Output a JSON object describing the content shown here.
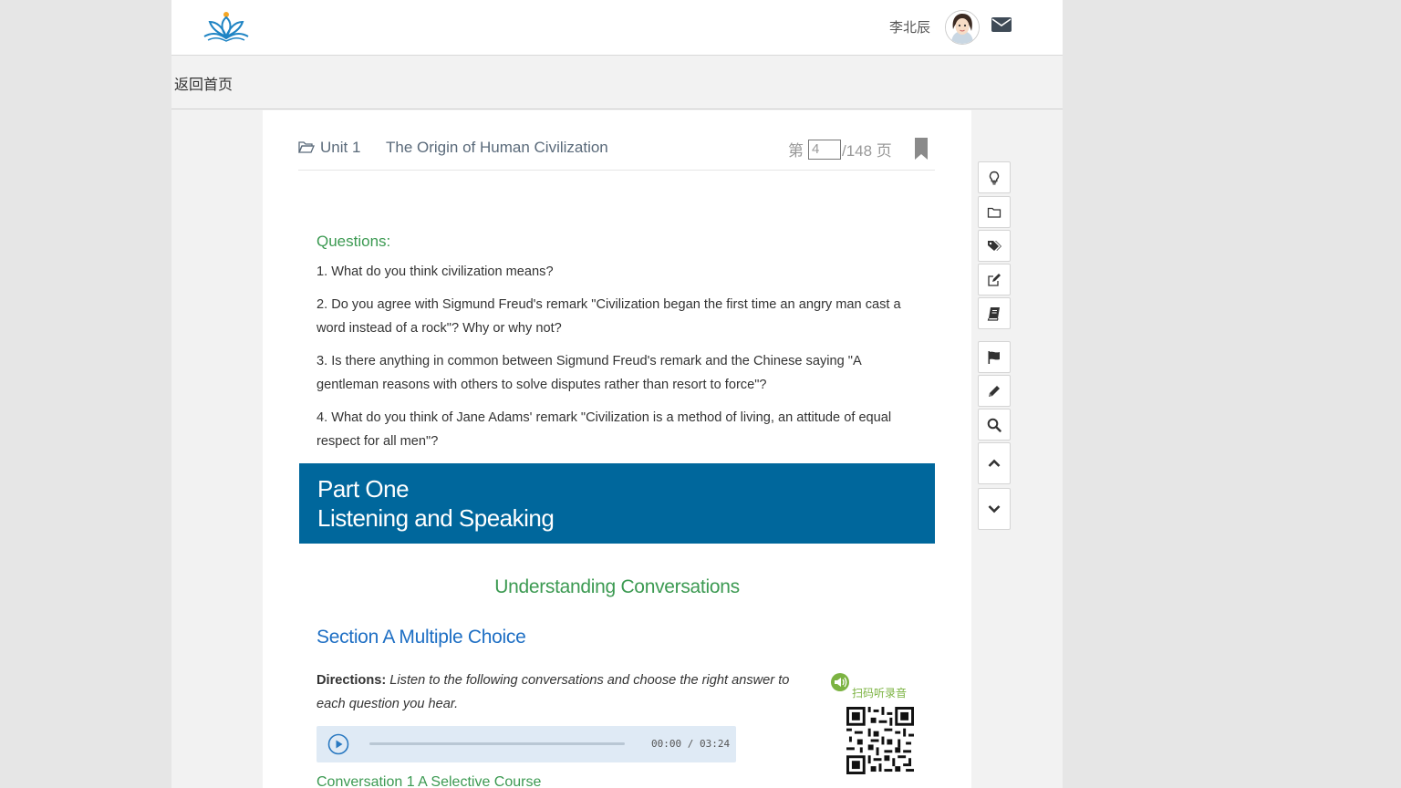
{
  "header": {
    "username": "李北辰",
    "back_link": "返回首页"
  },
  "page_header": {
    "unit_label": "Unit 1",
    "unit_title": "The Origin of Human Civilization",
    "page_prefix": "第",
    "page_current": "4",
    "page_suffix": "/148 页"
  },
  "content": {
    "questions_title": "Questions:",
    "questions": [
      "1. What do you think civilization means?",
      "2. Do you agree with Sigmund Freud's remark \"Civilization began the first time an angry man cast a word instead of a rock\"? Why or why not?",
      "3. Is there anything in common between Sigmund Freud's remark and the Chinese saying \"A gentleman reasons with others to solve disputes rather than resort to force\"?",
      "4. What do you think of Jane Adams' remark \"Civilization is a method of living, an attitude of equal respect for all men\"?"
    ],
    "part_line1": "Part One",
    "part_line2": "Listening and Speaking",
    "subsection_title": "Understanding Conversations",
    "section_title": "Section A Multiple Choice",
    "directions_label": "Directions:",
    "directions_text": "Listen to the following conversations and choose the right answer to each question you hear.",
    "qr_label": "扫码听录音",
    "audio_time": "00:00 / 03:24",
    "audio_progress": 0,
    "conversation_title": "Conversation 1 A Selective Course"
  },
  "toolbar": {
    "items": [
      "lightbulb-icon",
      "folder-icon",
      "tags-icon",
      "edit-icon",
      "book-icon",
      "flag-icon",
      "pencil-icon",
      "search-icon",
      "chevron-up-icon",
      "chevron-down-icon"
    ]
  },
  "colors": {
    "banner": "#00679c",
    "green_heading": "#3c9a52",
    "blue_heading": "#1e6fc4",
    "audio_bg": "#dfeaf5"
  }
}
